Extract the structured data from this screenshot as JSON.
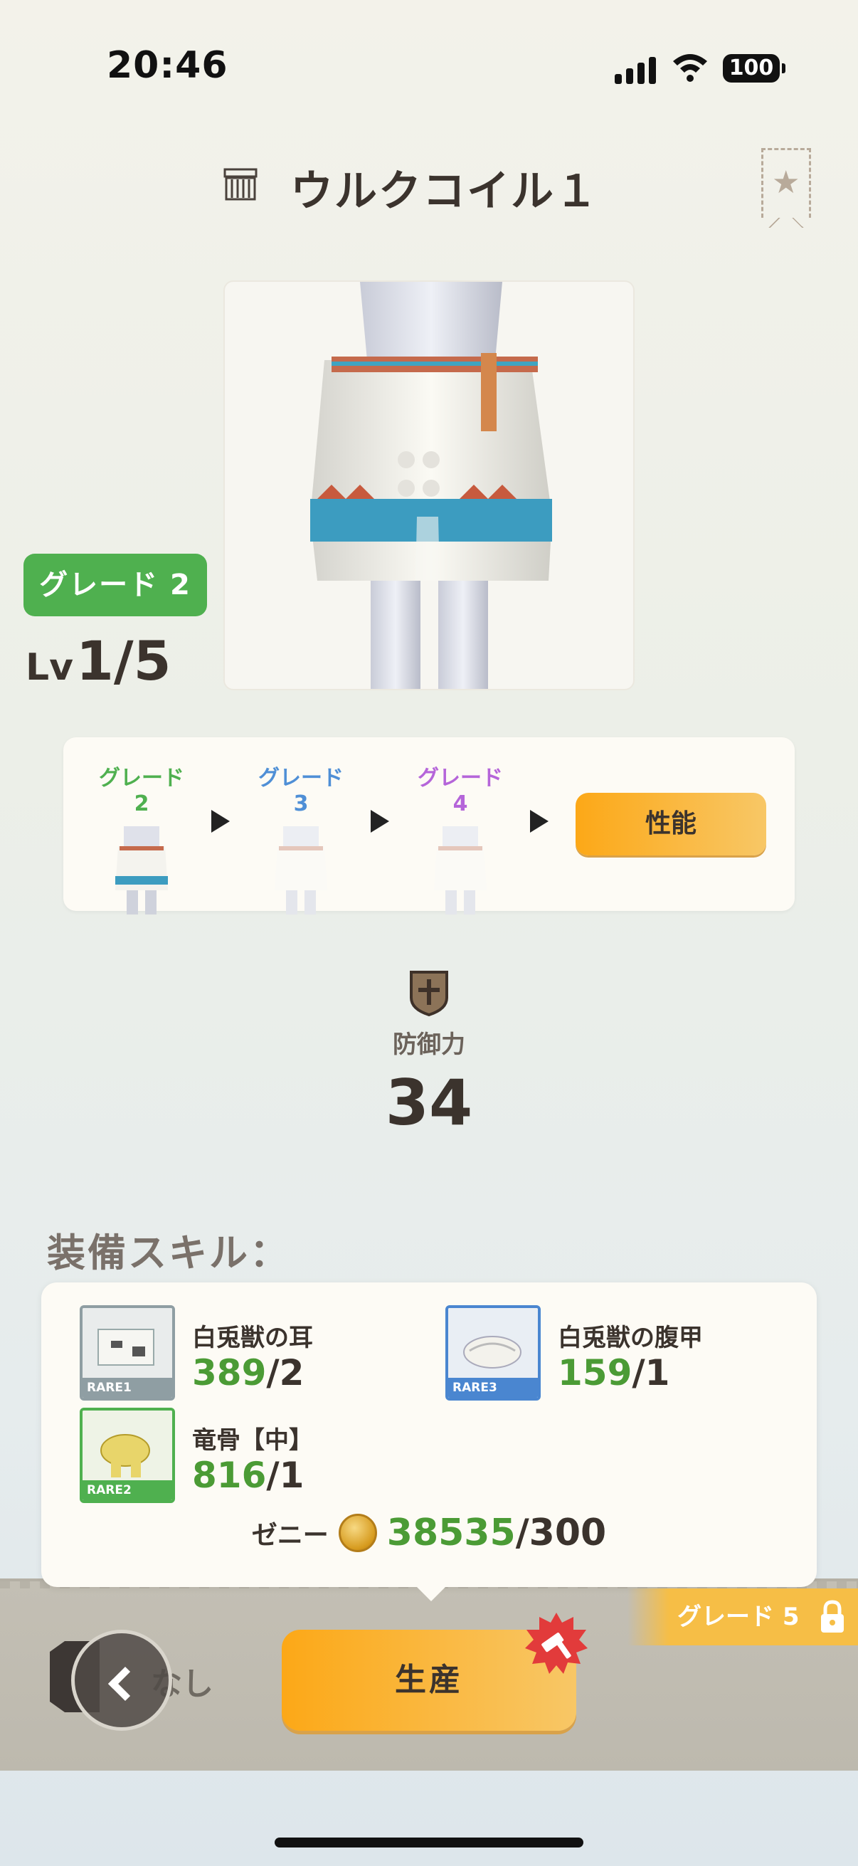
{
  "status_bar": {
    "time": "20:46",
    "battery": "100"
  },
  "header": {
    "title": "ウルクコイル１"
  },
  "equipment": {
    "grade_badge": "グレード 2",
    "level_prefix": "Lv",
    "level_value": "1/5"
  },
  "grade_steps": [
    {
      "label": "グレード 2",
      "color": "#4fb04f"
    },
    {
      "label": "グレード 3",
      "color": "#4f8fd6"
    },
    {
      "label": "グレード 4",
      "color": "#b565d9"
    }
  ],
  "performance_button": "性能",
  "defense": {
    "label": "防御力",
    "value": "34"
  },
  "skills": {
    "heading": "装備スキル："
  },
  "materials": [
    {
      "name": "白兎獣の耳",
      "have": "389",
      "need": "/2",
      "rarity": "RARE1",
      "rare_color": "#8f9ea3"
    },
    {
      "name": "白兎獣の腹甲",
      "have": "159",
      "need": "/1",
      "rarity": "RARE3",
      "rare_color": "#4a86d0"
    },
    {
      "name": "竜骨【中】",
      "have": "816",
      "need": "/1",
      "rarity": "RARE2",
      "rare_color": "#4fb04f"
    }
  ],
  "zeny": {
    "label": "ゼニー",
    "have": "38535",
    "need": "/300"
  },
  "bottom": {
    "next_grade": "グレード 5",
    "none_label": "なし",
    "produce_button": "生産"
  }
}
